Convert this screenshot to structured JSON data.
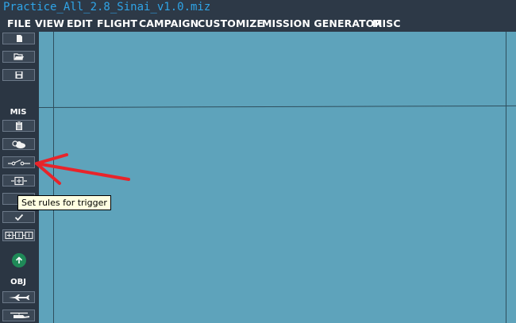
{
  "window": {
    "title": "Practice_All_2.8_Sinai_v1.0.miz"
  },
  "menu": {
    "items": [
      "FILE",
      "VIEW",
      "EDIT",
      "FLIGHT",
      "CAMPAIGN",
      "CUSTOMIZE",
      "MISSION GENERATOR",
      "MISC"
    ]
  },
  "sidebar": {
    "mis_label": "MIS",
    "obj_label": "OBJ",
    "buttons": [
      {
        "name": "new-file",
        "icon": "new-document-icon"
      },
      {
        "name": "open-file",
        "icon": "folder-open-icon"
      },
      {
        "name": "save-file",
        "icon": "floppy-disk-icon"
      },
      {
        "name": "mission-briefing",
        "icon": "clipboard-icon"
      },
      {
        "name": "weather",
        "icon": "cloud-sun-icon"
      },
      {
        "name": "trigger-rules",
        "icon": "trigger-switch-icon"
      },
      {
        "name": "trigger-zone",
        "icon": "zone-icon"
      },
      {
        "name": "checkmark",
        "icon": "checkmark-icon"
      },
      {
        "name": "flow",
        "icon": "flow-grid-icon"
      },
      {
        "name": "upload",
        "icon": "arrow-up-circle-icon"
      },
      {
        "name": "add-aircraft",
        "icon": "aircraft-icon"
      },
      {
        "name": "add-helicopter",
        "icon": "helicopter-icon"
      }
    ]
  },
  "tooltip": {
    "text": "Set rules for trigger"
  },
  "colors": {
    "title": "#2fa4e7",
    "map": "#5ea3bb",
    "toolbar": "#2b3643",
    "annotation_arrow": "#e8242a",
    "tooltip_bg": "#ffffe1"
  }
}
